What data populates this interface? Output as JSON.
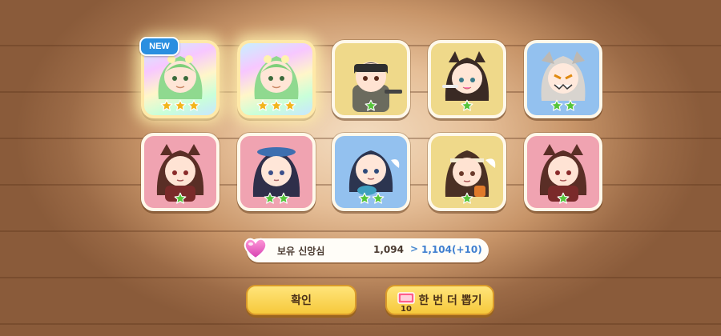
{
  "results": [
    {
      "id": "c1",
      "rarity": 3,
      "frame": "rainbow",
      "is_new": true
    },
    {
      "id": "c2",
      "rarity": 3,
      "frame": "rainbow",
      "is_new": false
    },
    {
      "id": "c3",
      "rarity": 1,
      "frame": "yellow",
      "is_new": false
    },
    {
      "id": "c4",
      "rarity": 1,
      "frame": "yellow",
      "is_new": false
    },
    {
      "id": "c5",
      "rarity": 2,
      "frame": "blue",
      "is_new": false
    },
    {
      "id": "c6",
      "rarity": 1,
      "frame": "pink",
      "is_new": false
    },
    {
      "id": "c7",
      "rarity": 2,
      "frame": "pink",
      "is_new": false
    },
    {
      "id": "c8",
      "rarity": 2,
      "frame": "blue",
      "is_new": false
    },
    {
      "id": "c9",
      "rarity": 1,
      "frame": "yellow",
      "is_new": false
    },
    {
      "id": "c10",
      "rarity": 1,
      "frame": "pink",
      "is_new": false
    }
  ],
  "badge": {
    "new_label": "NEW"
  },
  "faith": {
    "label": "보유 신앙심",
    "current": "1,094",
    "arrow": ">",
    "after": "1,104(+10)"
  },
  "buttons": {
    "confirm_label": "확인",
    "redraw_label": "한 번 더 뽑기",
    "redraw_ticket_count": "10"
  },
  "colors": {
    "star_gold": "#f2b51c",
    "star_green": "#55c43a",
    "accent_blue": "#3f7fd0",
    "button_yellow": "#f6c93c"
  },
  "icons": {
    "heart": "faith-heart-icon",
    "ticket": "ticket-icon",
    "star": "star-icon"
  }
}
